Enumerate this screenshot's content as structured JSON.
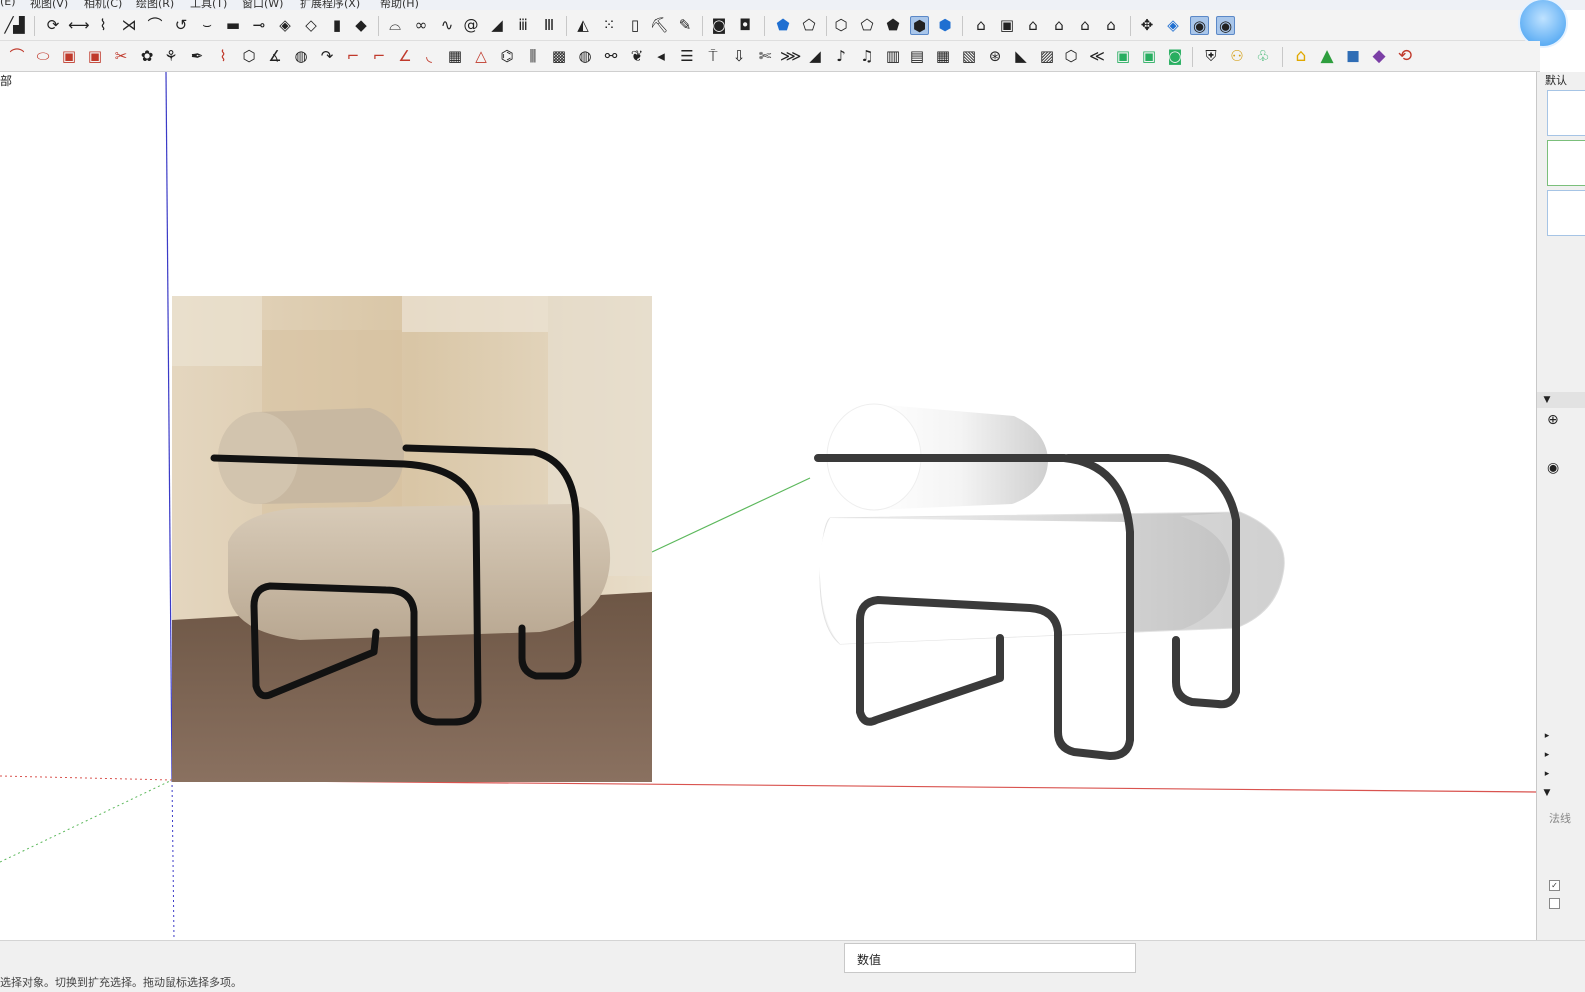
{
  "menu": [
    "(E)",
    "视图(V)",
    "相机(C)",
    "绘图(R)",
    "工具(T)",
    "窗口(W)",
    "扩展程序(X)",
    "帮助(H)"
  ],
  "viewport": {
    "label": "部"
  },
  "right_panel": {
    "tab_label": "默认",
    "rows": [
      "▼",
      "▸",
      "▸",
      "▸",
      "▼"
    ],
    "text_label": "法线"
  },
  "status": {
    "hint": "选择对象。切换到扩充选择。拖动鼠标选择多项。",
    "value_label": "数值"
  },
  "colors": {
    "axis_red": "#d9534f",
    "axis_green": "#5cb85c",
    "axis_blue": "#3b3bc7",
    "selected_tool": "#a9c6ea"
  }
}
